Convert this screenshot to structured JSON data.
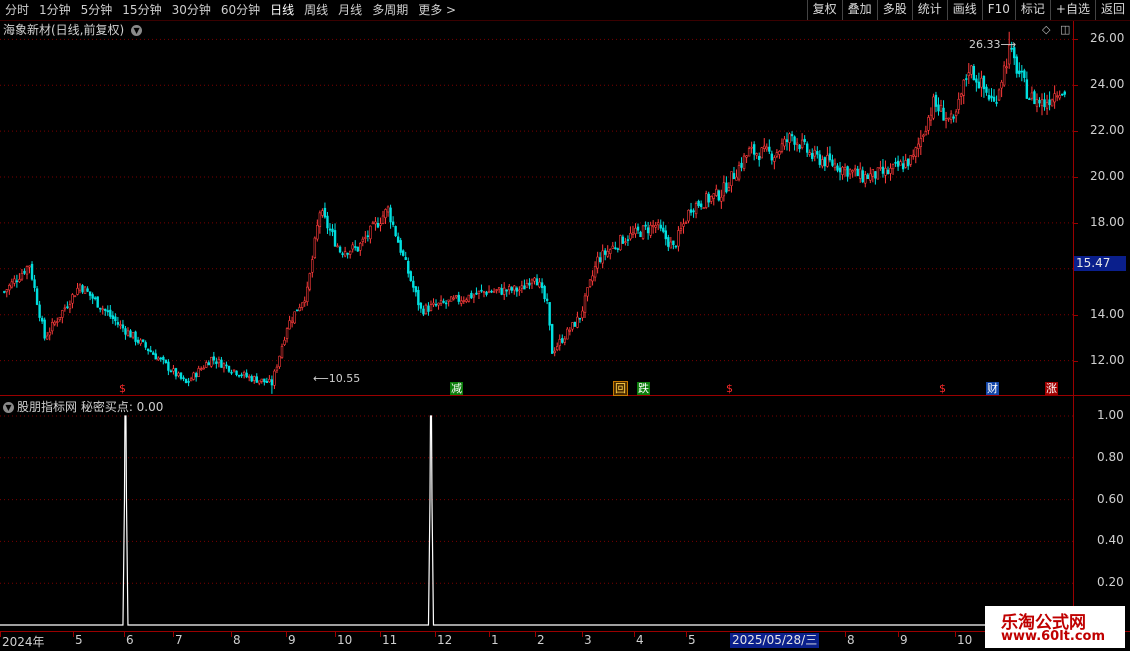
{
  "toolbar": {
    "periods": [
      "分时",
      "1分钟",
      "5分钟",
      "15分钟",
      "30分钟",
      "60分钟",
      "日线",
      "周线",
      "月线",
      "多周期",
      "更多"
    ],
    "active_period": "日线",
    "more_arrow": ">",
    "buttons": [
      "复权",
      "叠加",
      "多股",
      "统计",
      "画线",
      "F10",
      "标记",
      "+自选",
      "返回"
    ]
  },
  "chart": {
    "title": "海象新材(日线,前复权)",
    "price_axis_labels": [
      "26.00",
      "24.00",
      "22.00",
      "20.00",
      "18.00",
      "14.00",
      "12.00"
    ],
    "current_price": "15.47",
    "high_annotation": "26.33",
    "low_annotation": "10.55",
    "signals": [
      "$",
      "减",
      "回",
      "跌",
      "$",
      "$",
      "财",
      "涨"
    ],
    "colors": {
      "up": "#ff3b3b",
      "down": "#00e0e0",
      "grid": "#7a0000",
      "axis": "#9a0000"
    }
  },
  "indicator": {
    "title": "股朋指标网 秘密买点: 0.00",
    "axis_labels": [
      "1.00",
      "0.80",
      "0.60",
      "0.40",
      "0.20"
    ],
    "spikes": [
      {
        "bar": 48,
        "value": 1.0
      },
      {
        "bar": 169,
        "value": 1.0
      }
    ]
  },
  "date_axis": {
    "labels": [
      "2024年",
      "5",
      "6",
      "7",
      "8",
      "9",
      "10",
      "11",
      "12",
      "1",
      "2",
      "3",
      "4",
      "5",
      "2025/05/28/三",
      "8",
      "9",
      "10"
    ]
  },
  "watermark": {
    "line1": "乐淘公式网",
    "line2": "www.60lt.com"
  },
  "chart_data": {
    "type": "candlestick",
    "title": "海象新材(日线,前复权)",
    "ylim": [
      10.5,
      26.8
    ],
    "y_ticks": [
      12,
      14,
      16,
      18,
      20,
      22,
      24,
      26
    ],
    "x_range": [
      "2024",
      "2025-10"
    ],
    "anchors": [
      [
        0,
        15.0
      ],
      [
        10,
        16.2
      ],
      [
        16,
        13.0
      ],
      [
        30,
        15.3
      ],
      [
        45,
        13.6
      ],
      [
        58,
        12.4
      ],
      [
        72,
        11.0
      ],
      [
        82,
        12.1
      ],
      [
        96,
        11.3
      ],
      [
        106,
        11.0
      ],
      [
        112,
        13.5
      ],
      [
        120,
        15.0
      ],
      [
        125,
        18.5
      ],
      [
        133,
        16.8
      ],
      [
        140,
        16.9
      ],
      [
        152,
        18.6
      ],
      [
        158,
        16.5
      ],
      [
        165,
        14.2
      ],
      [
        178,
        14.6
      ],
      [
        190,
        15.0
      ],
      [
        205,
        15.1
      ],
      [
        210,
        15.8
      ],
      [
        215,
        14.4
      ],
      [
        217,
        12.4
      ],
      [
        228,
        13.9
      ],
      [
        235,
        16.4
      ],
      [
        245,
        17.3
      ],
      [
        258,
        17.9
      ],
      [
        265,
        16.9
      ],
      [
        272,
        18.7
      ],
      [
        284,
        19.3
      ],
      [
        295,
        21.1
      ],
      [
        305,
        21.0
      ],
      [
        312,
        21.8
      ],
      [
        320,
        20.9
      ],
      [
        330,
        20.5
      ],
      [
        340,
        20.0
      ],
      [
        350,
        20.2
      ],
      [
        360,
        20.8
      ],
      [
        368,
        23.2
      ],
      [
        376,
        22.3
      ],
      [
        382,
        24.8
      ],
      [
        392,
        23.2
      ],
      [
        398,
        25.5
      ],
      [
        406,
        23.5
      ],
      [
        412,
        23.2
      ],
      [
        418,
        23.9
      ],
      [
        420,
        23.6
      ]
    ],
    "low": {
      "value": 10.55
    },
    "high": {
      "value": 26.33
    }
  }
}
